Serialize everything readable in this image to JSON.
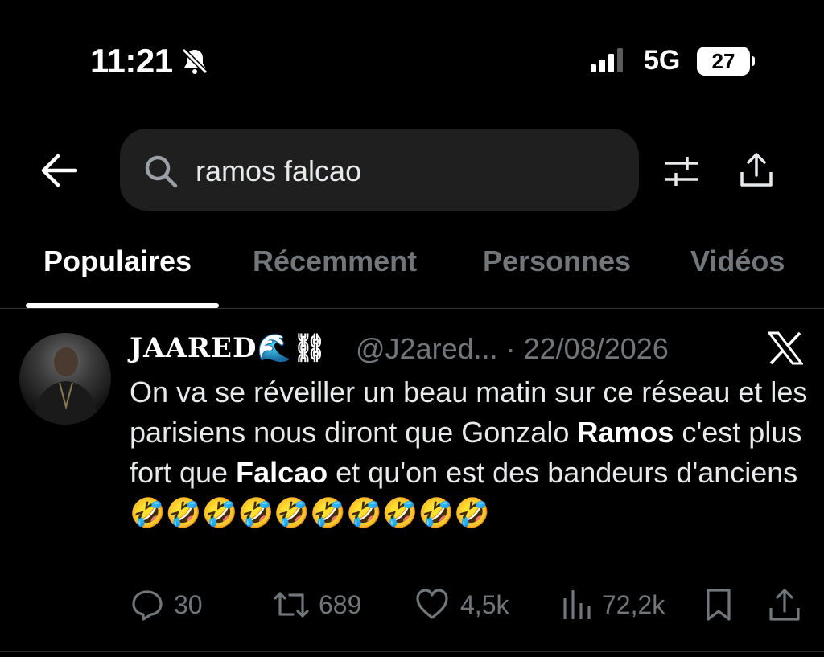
{
  "status_bar": {
    "time": "11:21",
    "network": "5G",
    "battery": "27"
  },
  "search": {
    "query": "ramos falcao"
  },
  "tabs": [
    {
      "label": "Populaires",
      "active": true
    },
    {
      "label": "Récemment",
      "active": false
    },
    {
      "label": "Personnes",
      "active": false
    },
    {
      "label": "Vidéos",
      "active": false
    }
  ],
  "tweet": {
    "display_name": "JAARED🌊⛓",
    "handle_date": "@J2ared... · 22/08/2026",
    "text_parts": [
      "On va se réveiller un beau matin sur ce réseau et les parisiens nous diront que Gonzalo ",
      "Ramos",
      " c'est plus fort que ",
      "Falcao",
      " et qu'on est des bandeurs d'anciens 🤣🤣🤣🤣🤣🤣🤣🤣🤣🤣"
    ],
    "replies": "30",
    "retweets": "689",
    "likes": "4,5k",
    "views": "72,2k"
  },
  "colors": {
    "background": "#000000",
    "muted": "#71767b",
    "text": "#e7e9ea"
  }
}
